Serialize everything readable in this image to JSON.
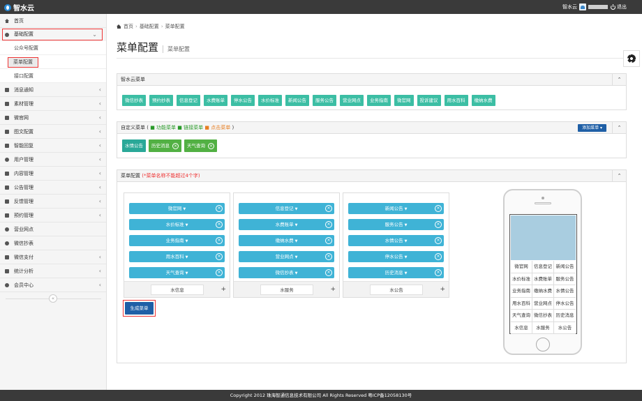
{
  "topbar": {
    "logo_text": "智水云",
    "user_label": "智水云",
    "logout_label": "退出"
  },
  "sidebar": {
    "items": [
      {
        "label": "首页"
      },
      {
        "label": "基础配置"
      },
      {
        "label": "消息通知"
      },
      {
        "label": "素材管理"
      },
      {
        "label": "微官网"
      },
      {
        "label": "图文配置"
      },
      {
        "label": "智能回复"
      },
      {
        "label": "用户管理"
      },
      {
        "label": "内容管理"
      },
      {
        "label": "公告管理"
      },
      {
        "label": "反馈管理"
      },
      {
        "label": "预约管理"
      },
      {
        "label": "营业网点"
      },
      {
        "label": "微信抄表"
      },
      {
        "label": "微信支付"
      },
      {
        "label": "统计分析"
      },
      {
        "label": "会员中心"
      }
    ],
    "sub_items": [
      {
        "label": "公众号配置"
      },
      {
        "label": "菜单配置"
      },
      {
        "label": "接口配置"
      }
    ]
  },
  "breadcrumb": {
    "home": "首页",
    "level1": "基础配置",
    "level2": "菜单配置"
  },
  "page": {
    "title": "菜单配置",
    "subtitle": "菜单配置"
  },
  "panel_zsy": {
    "title": "智水云菜单",
    "buttons": [
      "微信抄表",
      "预约抄表",
      "信息登记",
      "水费账单",
      "停水公告",
      "水价标准",
      "新闻公告",
      "服务公告",
      "营业网点",
      "业务指南",
      "微官网",
      "投诉建议",
      "用水百科",
      "缴纳水费"
    ]
  },
  "panel_custom": {
    "title_prefix": "自定义菜单 (",
    "legend_func": "■ 功能菜单",
    "legend_link": "■ 链接菜单",
    "legend_click": "■ 点击菜单",
    "title_suffix": ")",
    "add_label": "添加菜单 ▾",
    "buttons": [
      "水情公告",
      "历史消息",
      "天气查询"
    ]
  },
  "panel_config": {
    "title": "菜单配置",
    "note": "(*菜单名称不能超过4个字)",
    "columns": [
      {
        "items": [
          "微官网",
          "水价标准",
          "业务指南",
          "用水百科",
          "天气查询"
        ],
        "name": "水信息"
      },
      {
        "items": [
          "信息登记",
          "水费账单",
          "缴纳水费",
          "营业网点",
          "微信抄表"
        ],
        "name": "水服务"
      },
      {
        "items": [
          "新闻公告",
          "服务公告",
          "水情公告",
          "停水公告",
          "历史消息"
        ],
        "name": "水公告"
      }
    ],
    "generate_label": "生成菜单",
    "phone_grid": [
      [
        "微官网",
        "信息登记",
        "新闻公告"
      ],
      [
        "水价标准",
        "水费账单",
        "服务公告"
      ],
      [
        "业务指南",
        "缴纳水费",
        "水情公告"
      ],
      [
        "用水百科",
        "营业网点",
        "停水公告"
      ],
      [
        "天气查询",
        "微信抄表",
        "历史消息"
      ],
      [
        "水信息",
        "水服务",
        "水公告"
      ]
    ]
  },
  "footer": {
    "text": "Copyright 2012 珠海智通信息技术有限公司 All Rights Reserved 粤ICP备12058130号"
  }
}
